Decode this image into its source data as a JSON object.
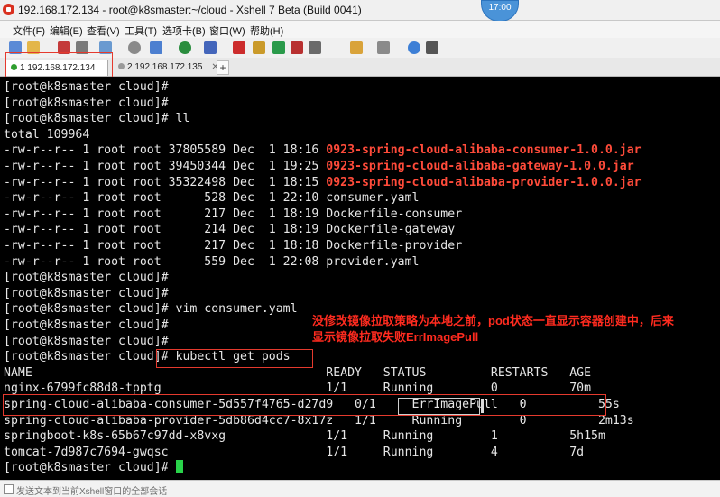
{
  "window": {
    "title": "192.168.172.134 - root@k8smaster:~/cloud - Xshell 7 Beta (Build 0041)"
  },
  "clock": "17:00",
  "menu": [
    "文件(F)",
    "编辑(E)",
    "查看(V)",
    "工具(T)",
    "选项卡(B)",
    "窗口(W)",
    "帮助(H)"
  ],
  "tabs": [
    {
      "label": "1 192.168.172.134",
      "active": true
    },
    {
      "label": "2 192.168.172.135",
      "active": false
    }
  ],
  "tab_add": "+",
  "terminal": {
    "lines": [
      "[root@k8smaster cloud]#",
      "[root@k8smaster cloud]#",
      "[root@k8smaster cloud]# ll",
      "total 109964",
      "-rw-r--r-- 1 root root 37805589 Dec  1 18:16 ",
      "-rw-r--r-- 1 root root 39450344 Dec  1 19:25 ",
      "-rw-r--r-- 1 root root 35322498 Dec  1 18:15 ",
      "-rw-r--r-- 1 root root      528 Dec  1 22:10 consumer.yaml",
      "-rw-r--r-- 1 root root      217 Dec  1 18:19 Dockerfile-consumer",
      "-rw-r--r-- 1 root root      214 Dec  1 18:19 Dockerfile-gateway",
      "-rw-r--r-- 1 root root      217 Dec  1 18:18 Dockerfile-provider",
      "-rw-r--r-- 1 root root      559 Dec  1 22:08 provider.yaml",
      "[root@k8smaster cloud]#",
      "[root@k8smaster cloud]#",
      "[root@k8smaster cloud]# vim consumer.yaml",
      "[root@k8smaster cloud]#",
      "[root@k8smaster cloud]#",
      "[root@k8smaster cloud]# kubectl get pods",
      "NAME                                         READY   STATUS         RESTARTS   AGE",
      "nginx-6799fc88d8-tpptg                       1/1     Running        0          70m",
      "spring-cloud-alibaba-consumer-5d557f4765-d27d9   0/1     ErrImagePull   0          55s",
      "spring-cloud-alibaba-provider-5db86d4cc7-8x17z   1/1     Running        0          2m13s",
      "springboot-k8s-65b67c97dd-x8vxg              1/1     Running        1          5h15m",
      "tomcat-7d987c7694-gwqsc                      1/1     Running        4          7d",
      "[root@k8smaster cloud]# "
    ],
    "jar_files": [
      "0923-spring-cloud-alibaba-consumer-1.0.0.jar",
      "0923-spring-cloud-alibaba-gateway-1.0.0.jar",
      "0923-spring-cloud-alibaba-provider-1.0.0.jar"
    ]
  },
  "annotation": {
    "line1": "没修改镜像拉取策略为本地之前，pod状态一直显示容器创建中，后来",
    "line2": "显示镜像拉取失败ErrImagePull"
  },
  "status_bar": {
    "hint": "发送文本到当前Xshell窗口的全部会话"
  },
  "colors": {
    "jar": "#ff4b3a",
    "annotation": "#ff2b1f",
    "highlight_box": "#e53a2e",
    "cursor": "#29d34a"
  }
}
